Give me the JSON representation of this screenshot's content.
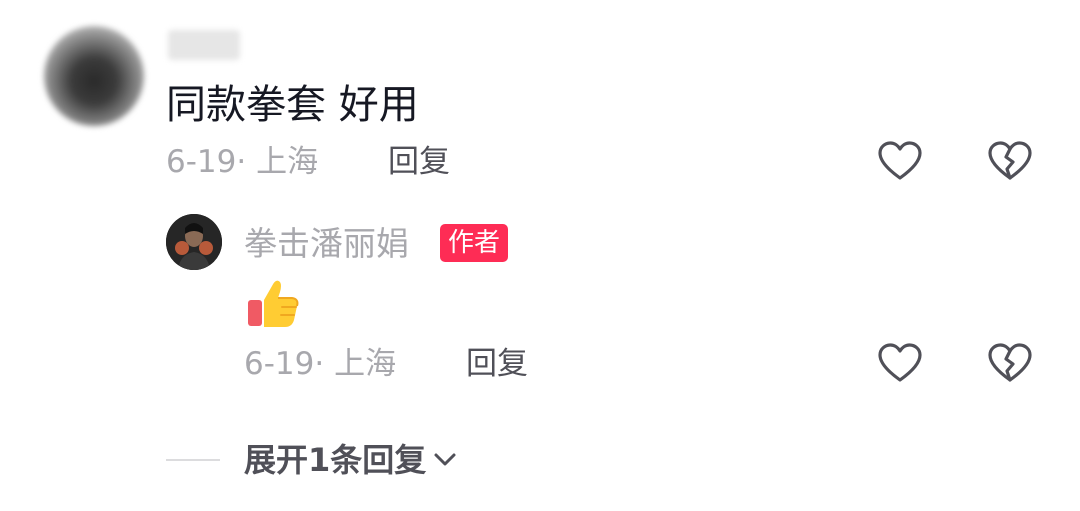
{
  "comment": {
    "text": "同款拳套 好用",
    "date": "6-19",
    "separator": "·",
    "location": "上海",
    "reply_label": "回复",
    "like_icon": "heart-outline-icon",
    "dislike_icon": "broken-heart-icon"
  },
  "reply": {
    "author_name": "拳击潘丽娟",
    "author_badge": "作者",
    "content_icon": "thumbs-up-emoji",
    "date": "6-19",
    "separator": "·",
    "location": "上海",
    "reply_label": "回复",
    "like_icon": "heart-outline-icon",
    "dislike_icon": "broken-heart-icon"
  },
  "expand": {
    "label": "展开1条回复",
    "icon": "chevron-down-icon"
  },
  "colors": {
    "badge_bg": "#fe2c55",
    "meta_text": "#a8a8ad",
    "reply_text": "#505058",
    "primary_text": "#161823",
    "icon_stroke": "#505058"
  }
}
